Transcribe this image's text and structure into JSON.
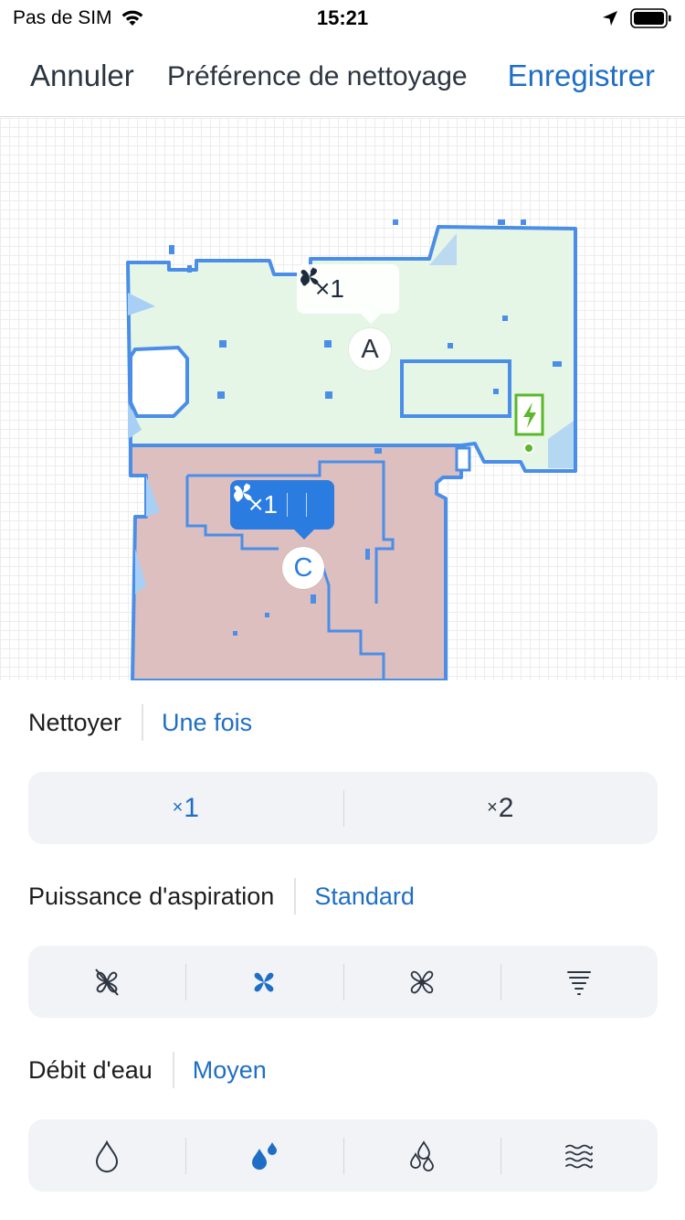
{
  "status": {
    "carrier": "Pas de SIM",
    "time": "15:21"
  },
  "nav": {
    "cancel": "Annuler",
    "title": "Préférence de nettoyage",
    "save": "Enregistrer"
  },
  "map": {
    "room_a": {
      "label": "A",
      "passes": "×1",
      "selected": false
    },
    "room_c": {
      "label": "C",
      "passes": "×1",
      "selected": true
    },
    "colors": {
      "room_a_fill": "#e6f6e6",
      "room_c_fill": "#dcbfbe",
      "wall": "#4a8ee8",
      "wall_light": "#a8cff5",
      "dock": "#5ab82a"
    }
  },
  "clean": {
    "label": "Nettoyer",
    "value": "Une fois",
    "options": [
      {
        "text": "1",
        "active": true
      },
      {
        "text": "2",
        "active": false
      }
    ]
  },
  "suction": {
    "label": "Puissance d'aspiration",
    "value": "Standard",
    "options": [
      {
        "icon": "fan-off-icon",
        "active": false
      },
      {
        "icon": "fan-standard-icon",
        "active": true
      },
      {
        "icon": "fan-strong-icon",
        "active": false
      },
      {
        "icon": "tornado-max-icon",
        "active": false
      }
    ]
  },
  "water": {
    "label": "Débit d'eau",
    "value": "Moyen",
    "options": [
      {
        "icon": "drop-low-icon",
        "active": false
      },
      {
        "icon": "drops-medium-icon",
        "active": true
      },
      {
        "icon": "drops-high-icon",
        "active": false
      },
      {
        "icon": "water-waves-icon",
        "active": false
      }
    ]
  },
  "accent": "#1f6ec5"
}
